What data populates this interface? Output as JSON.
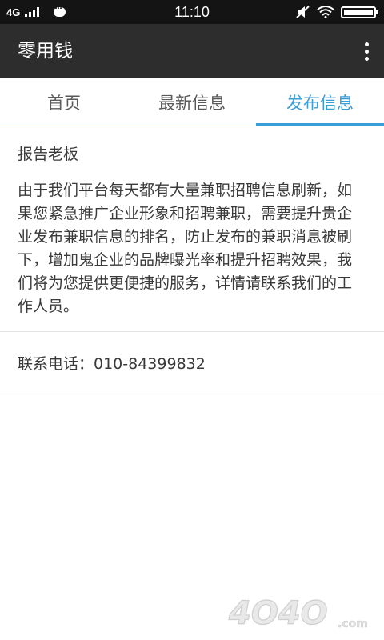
{
  "status_bar": {
    "network": "4G",
    "time": "11:10"
  },
  "app_bar": {
    "title": "零用钱",
    "menu_icon": "overflow-menu-icon"
  },
  "tabs": [
    {
      "label": "首页",
      "active": false
    },
    {
      "label": "最新信息",
      "active": false
    },
    {
      "label": "发布信息",
      "active": true
    }
  ],
  "content": {
    "section_title": "报告老板",
    "body": "由于我们平台每天都有大量兼职招聘信息刷新，如果您紧急推广企业形象和招聘兼职，需要提升贵企业发布兼职信息的排名，防止发布的兼职消息被刷下，增加鬼企业的品牌曝光率和提升招聘效果，我们将为您提供更便捷的服务，详情请联系我们的工作人员。",
    "contact": "联系电话：010-84399832"
  },
  "watermark": {
    "text": "4O4O",
    "suffix": ".com"
  },
  "colors": {
    "accent": "#3a9ed8",
    "app_bar": "#2d2d2d",
    "status_bar": "#141414"
  }
}
